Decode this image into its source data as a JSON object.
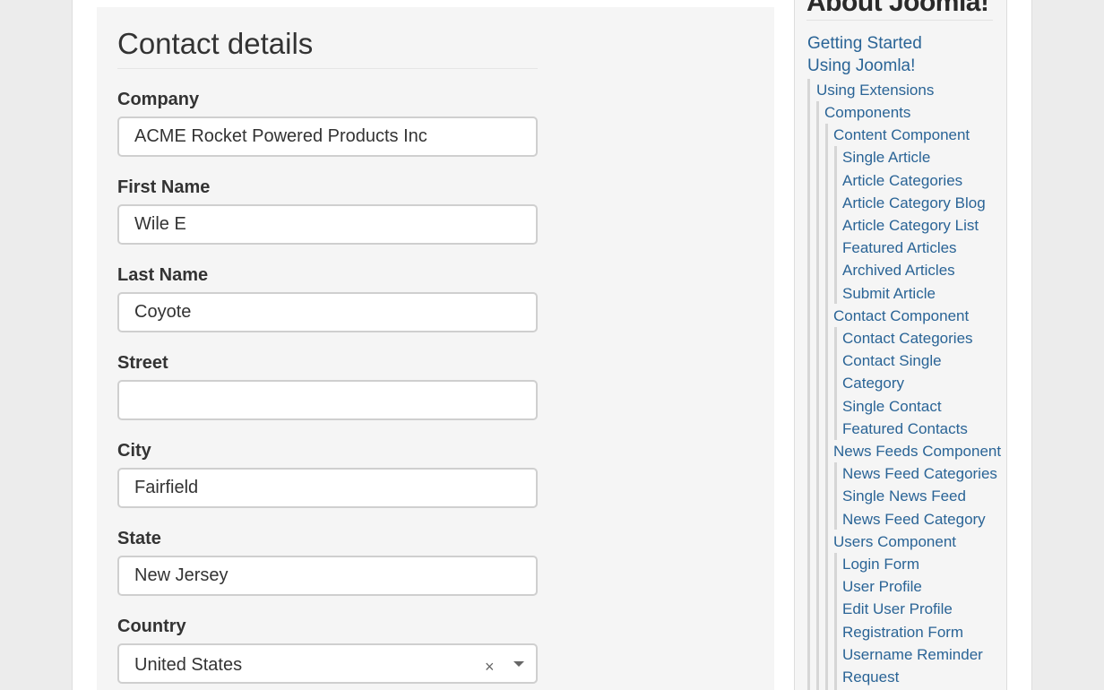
{
  "form": {
    "title": "Contact details",
    "fields": [
      {
        "label": "Company",
        "value": "ACME Rocket Powered Products Inc"
      },
      {
        "label": "First Name",
        "value": "Wile E"
      },
      {
        "label": "Last Name",
        "value": "Coyote"
      },
      {
        "label": "Street",
        "value": ""
      },
      {
        "label": "City",
        "value": "Fairfield"
      },
      {
        "label": "State",
        "value": "New Jersey"
      },
      {
        "label": "Country",
        "value": "United States",
        "clear": "×"
      }
    ]
  },
  "sidebar": {
    "title": "About Joomla!",
    "items": [
      "Getting Started",
      "Using Joomla!",
      "Using Extensions",
      "Components",
      "Content Component",
      "Single Article",
      "Article Categories",
      "Article Category Blog",
      "Article Category List",
      "Featured Articles",
      "Archived Articles",
      "Submit Article",
      "Contact Component",
      "Contact Categories",
      "Contact Single",
      "Category",
      "Single Contact",
      "Featured Contacts",
      "News Feeds Component",
      "News Feed Categories",
      "Single News Feed",
      "News Feed Category",
      "Users Component",
      "Login Form",
      "User Profile",
      "Edit User Profile",
      "Registration Form",
      "Username Reminder",
      "Request"
    ]
  },
  "colors": {
    "link": "#2a6496",
    "text": "#333333"
  }
}
